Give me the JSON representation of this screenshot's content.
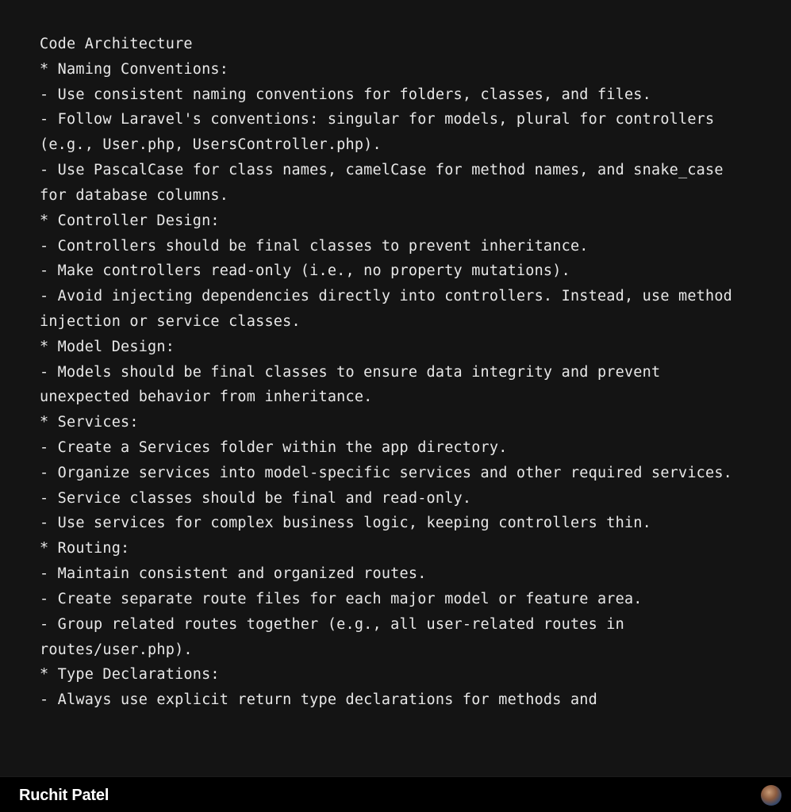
{
  "document": {
    "title": "Code Architecture",
    "sections": [
      {
        "heading": "Naming Conventions:",
        "items": [
          "Use consistent naming conventions for folders, classes, and files.",
          "Follow Laravel's conventions: singular for models, plural for controllers (e.g., User.php, UsersController.php).",
          "Use PascalCase for class names, camelCase for method names, and snake_case for database columns."
        ]
      },
      {
        "heading": "Controller Design:",
        "items": [
          "Controllers should be final classes to prevent inheritance.",
          "Make controllers read-only (i.e., no property mutations).",
          "Avoid injecting dependencies directly into controllers. Instead, use method injection or service classes."
        ]
      },
      {
        "heading": "Model Design:",
        "items": [
          "Models should be final classes to ensure data integrity and prevent unexpected behavior from inheritance."
        ]
      },
      {
        "heading": "Services:",
        "items": [
          "Create a Services folder within the app directory.",
          "Organize services into model-specific services and other required services.",
          "Service classes should be final and read-only.",
          "Use services for complex business logic, keeping controllers thin."
        ]
      },
      {
        "heading": "Routing:",
        "items": [
          "Maintain consistent and organized routes.",
          "Create separate route files for each major model or feature area.",
          "Group related routes together (e.g., all user-related routes in routes/user.php)."
        ]
      },
      {
        "heading": "Type Declarations:",
        "items": [
          "Always use explicit return type declarations for methods and"
        ]
      }
    ]
  },
  "footer": {
    "author": "Ruchit Patel"
  }
}
